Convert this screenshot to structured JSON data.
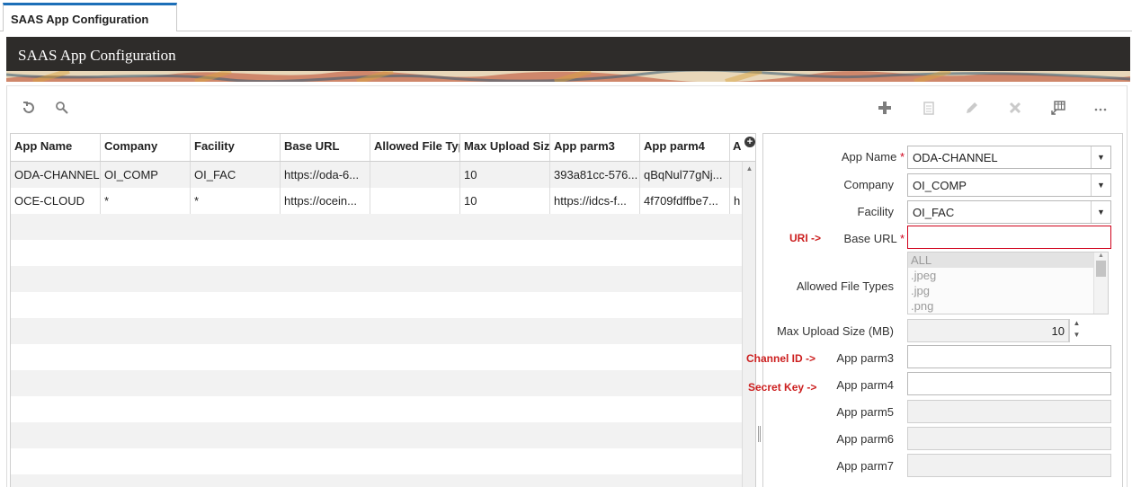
{
  "tab": {
    "label": "SAAS App Configuration"
  },
  "header": {
    "title": "SAAS App Configuration"
  },
  "toolbar": {
    "left": [
      {
        "name": "refresh-icon",
        "glyph": "↻"
      },
      {
        "name": "search-icon",
        "glyph": "⚲"
      }
    ],
    "right": [
      {
        "name": "add-icon",
        "glyph": "✚"
      },
      {
        "name": "copy-icon",
        "glyph": "▤"
      },
      {
        "name": "edit-icon",
        "glyph": "✎"
      },
      {
        "name": "delete-icon",
        "glyph": "✕"
      },
      {
        "name": "export-icon",
        "glyph": "⊞"
      },
      {
        "name": "more-icon",
        "glyph": "···"
      }
    ]
  },
  "grid": {
    "columns": [
      "App Name",
      "Company",
      "Facility",
      "Base URL",
      "Allowed File Typ",
      "Max Upload Siz",
      "App parm3",
      "App parm4",
      "A"
    ],
    "rows": [
      [
        "ODA-CHANNEL",
        "OI_COMP",
        "OI_FAC",
        "https://oda-6...",
        "",
        "10",
        "393a81cc-576...",
        "qBqNul77gNj...",
        ""
      ],
      [
        "OCE-CLOUD",
        "*",
        "*",
        "https://ocein...",
        "",
        "10",
        "https://idcs-f...",
        "4f709fdffbe7...",
        "h"
      ]
    ]
  },
  "form": {
    "app_name": {
      "label": "App Name",
      "value": "ODA-CHANNEL",
      "required": "*"
    },
    "company": {
      "label": "Company",
      "value": "OI_COMP"
    },
    "facility": {
      "label": "Facility",
      "value": "OI_FAC"
    },
    "base_url": {
      "label": "Base URL",
      "value": "",
      "required": "*",
      "annotation": "URI ->"
    },
    "allowed_file_types": {
      "label": "Allowed File Types",
      "options": [
        "ALL",
        ".jpeg",
        ".jpg",
        ".png"
      ]
    },
    "max_upload": {
      "label": "Max Upload Size (MB)",
      "value": "10"
    },
    "app_parm3": {
      "label": "App parm3",
      "value": "",
      "annotation": "Channel ID ->"
    },
    "app_parm4": {
      "label": "App parm4",
      "value": "",
      "annotation": "Secret Key ->"
    },
    "app_parm5": {
      "label": "App parm5",
      "value": ""
    },
    "app_parm6": {
      "label": "App parm6",
      "value": ""
    },
    "app_parm7": {
      "label": "App parm7",
      "value": ""
    }
  },
  "colors": {
    "accent": "#1d6fb8",
    "banner": "#2e2c2a",
    "annotation": "#cc1f1f",
    "required": "#d0021b"
  }
}
